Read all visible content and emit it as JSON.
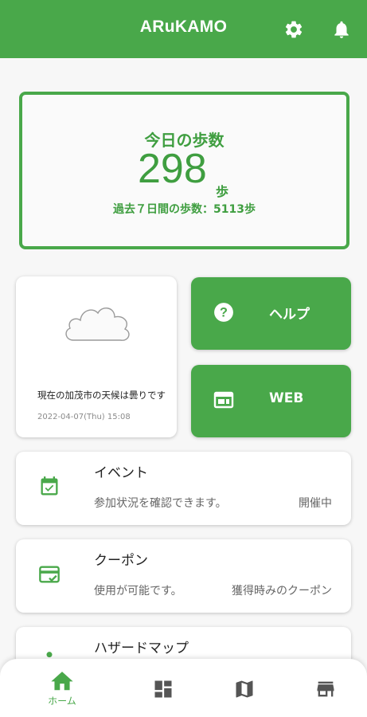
{
  "appbar": {
    "title": "ARuKAMO",
    "settings_icon": "gear-icon",
    "notification_icon": "bell-icon",
    "color": "#49a84a"
  },
  "steps": {
    "label": "今日の歩数",
    "value": "298",
    "unit": "歩",
    "weekly": "過去７日間の歩数：5113歩"
  },
  "weather": {
    "icon": "cloud-icon",
    "text": "現在の加茂市の天候は曇りです",
    "timestamp": "2022-04-07(Thu) 15:08"
  },
  "help_button": {
    "icon": "help-circle-icon",
    "label": "ヘルプ"
  },
  "web_button": {
    "icon": "web-browser-icon",
    "label": "WEB"
  },
  "list": [
    {
      "icon": "calendar-check-icon",
      "title": "イベント",
      "description": "参加状況を確認できます。",
      "status": "開催中"
    },
    {
      "icon": "coupon-card-icon",
      "title": "クーポン",
      "description": "使用が可能です。",
      "status": "獲得時みのクーポン"
    },
    {
      "icon": "hazard-person-icon",
      "title": "ハザードマップ"
    }
  ],
  "nav": {
    "home_label": "ホーム",
    "home_icon": "home-icon",
    "dashboard_icon": "dashboard-icon",
    "map_icon": "map-icon",
    "store_icon": "store-icon",
    "active_color": "#49a84a",
    "inactive_color": "#555555"
  }
}
